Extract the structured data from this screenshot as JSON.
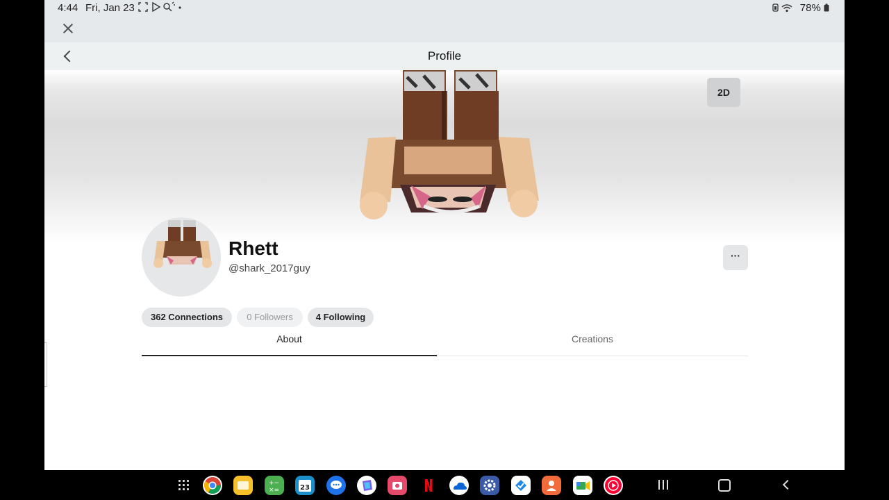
{
  "status_bar": {
    "time": "4:44",
    "date": "Fri, Jan 23",
    "battery": "78%",
    "notification_icons": [
      "screenshot-icon",
      "play-store-icon",
      "search-sparkle-icon",
      "dot-icon"
    ]
  },
  "header": {
    "title": "Profile"
  },
  "hero": {
    "view_toggle": "2D"
  },
  "profile": {
    "display_name": "Rhett",
    "username": "@shark_2017guy",
    "more_label": "···"
  },
  "stats": {
    "connections": "362 Connections",
    "followers": "0 Followers",
    "following": "4 Following"
  },
  "tabs": [
    {
      "label": "About",
      "active": true
    },
    {
      "label": "Creations",
      "active": false
    }
  ],
  "taskbar": {
    "apps": [
      "apps-grid-icon",
      "chrome-icon",
      "files-icon",
      "calculator-icon",
      "calendar-icon",
      "messages-icon",
      "office-icon",
      "screen-recorder-icon",
      "netflix-icon",
      "onedrive-icon",
      "settings-icon",
      "tasks-icon",
      "contacts-icon",
      "meet-icon",
      "youtube-music-icon"
    ],
    "calendar_day": "23"
  },
  "colors": {
    "accent_dark": "#222222",
    "pill_bg": "#e4e6e8",
    "header_bg": "#eef1f2"
  }
}
